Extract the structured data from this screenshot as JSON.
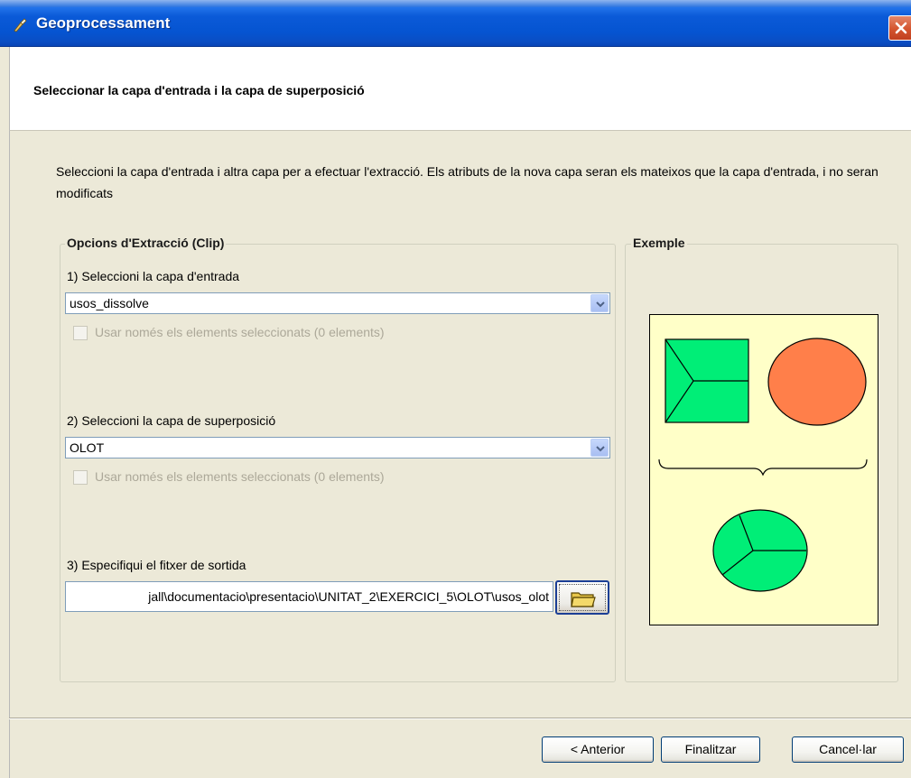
{
  "window": {
    "title": "Geoprocessament"
  },
  "header": {
    "title": "Seleccionar la capa d'entrada i la capa de superposició"
  },
  "description": {
    "text": "Seleccioni la capa d'entrada i altra capa per a efectuar l'extracció. Els atributs de la nova capa seran els mateixos que la capa d'entrada, i no seran modificats"
  },
  "options": {
    "legend": "Opcions d'Extracció (Clip)",
    "input_layer_label": "1) Seleccioni la capa d'entrada",
    "input_layer_value": "usos_dissolve",
    "input_selected_only": "Usar només els elements seleccionats (0 elements)",
    "overlay_layer_label": "2) Seleccioni la capa de superposició",
    "overlay_layer_value": "OLOT",
    "overlay_selected_only": "Usar només els elements seleccionats (0 elements)",
    "output_file_label": "3) Especifiqui el fitxer de sortida",
    "output_file_value": "jall\\documentacio\\presentacio\\UNITAT_2\\EXERCICI_5\\OLOT\\usos_olot"
  },
  "example": {
    "legend": "Exemple",
    "colors": {
      "background": "#ffffc8",
      "green": "#00ee77",
      "orange": "#ff7f4a"
    }
  },
  "buttons": {
    "back": "< Anterior",
    "finish": "Finalitzar",
    "cancel": "Cancel·lar"
  },
  "icons": {
    "app": "app-icon",
    "close": "close-icon",
    "dropdown": "chevron-down-icon",
    "folder": "folder-icon"
  }
}
